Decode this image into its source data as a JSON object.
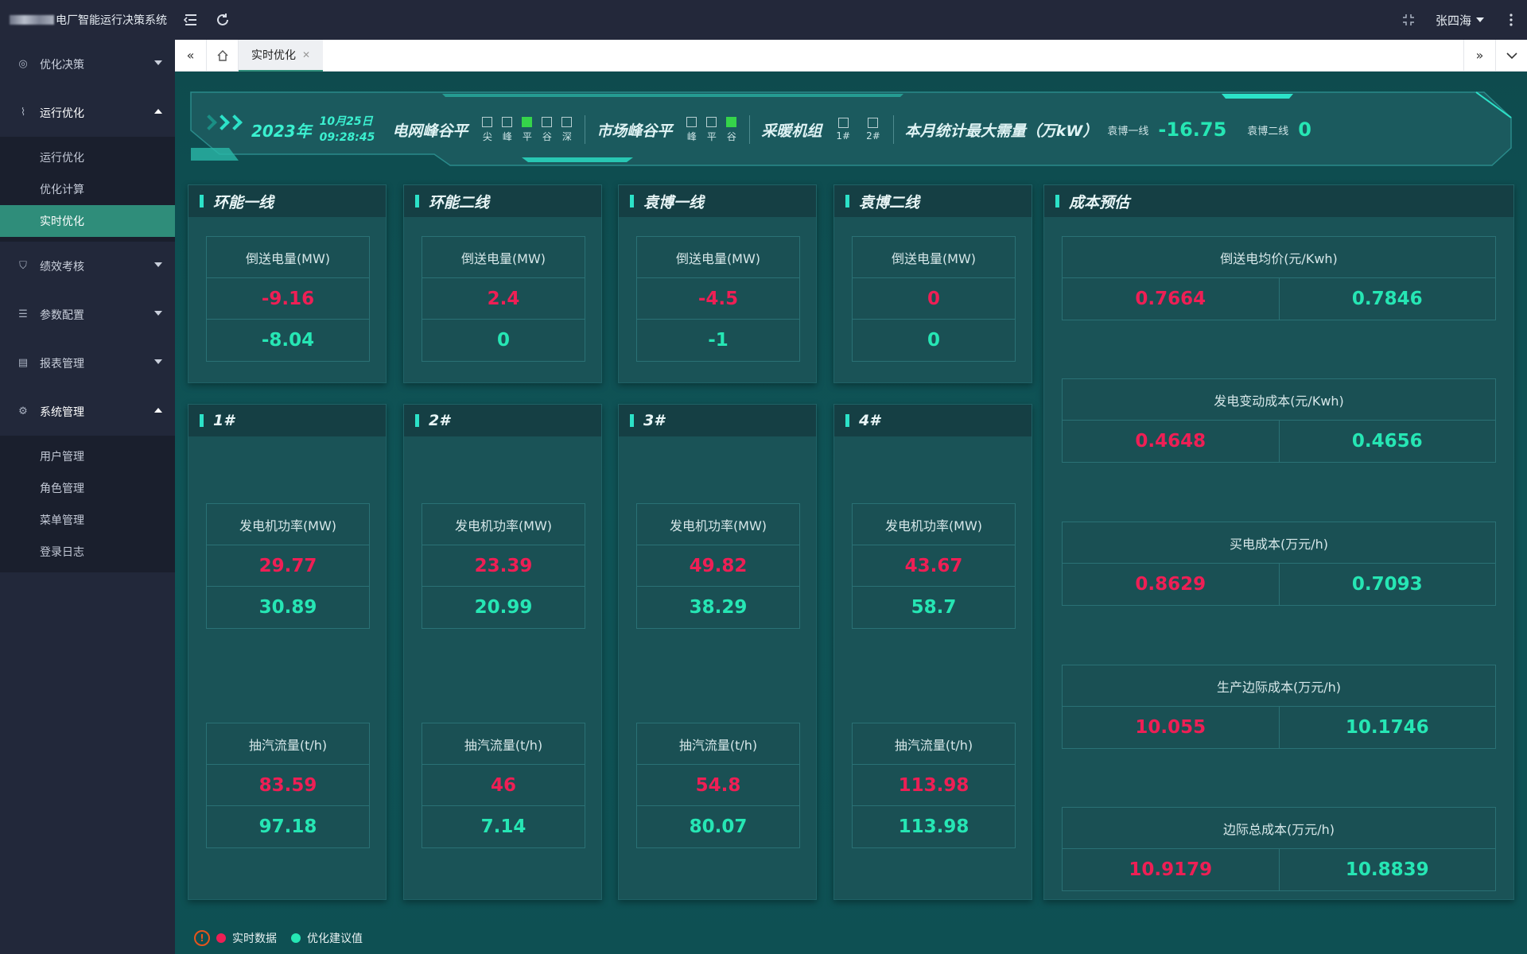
{
  "app": {
    "title": "电厂智能运行决策系统",
    "user": "张四海"
  },
  "sidebar": {
    "groups": [
      {
        "label": "优化决策",
        "icon": "target-icon"
      },
      {
        "label": "运行优化",
        "icon": "pulse-icon",
        "items": [
          "运行优化",
          "优化计算",
          "实时优化"
        ],
        "active_item": "实时优化"
      },
      {
        "label": "绩效考核",
        "icon": "shield-icon"
      },
      {
        "label": "参数配置",
        "icon": "sliders-icon"
      },
      {
        "label": "报表管理",
        "icon": "clipboard-icon"
      },
      {
        "label": "系统管理",
        "icon": "gear-icon",
        "items": [
          "用户管理",
          "角色管理",
          "菜单管理",
          "登录日志"
        ]
      }
    ]
  },
  "tabs": [
    {
      "label": "实时优化"
    }
  ],
  "header": {
    "year": "2023年",
    "date": "10月25日",
    "time": "09:28:45",
    "grid_title": "电网峰谷平",
    "grid_indicators": [
      {
        "label": "尖",
        "on": false
      },
      {
        "label": "峰",
        "on": false
      },
      {
        "label": "平",
        "on": true
      },
      {
        "label": "谷",
        "on": false
      },
      {
        "label": "深",
        "on": false
      }
    ],
    "market_title": "市场峰谷平",
    "market_indicators": [
      {
        "label": "峰",
        "on": false
      },
      {
        "label": "平",
        "on": false
      },
      {
        "label": "谷",
        "on": true
      }
    ],
    "heating_title": "采暖机组",
    "heating_indicators": [
      {
        "label": "1#",
        "on": false
      },
      {
        "label": "2#",
        "on": false
      }
    ],
    "max_demand_title": "本月统计最大需量（万kW）",
    "line1_label": "袁博一线",
    "line1_value": "-16.75",
    "line2_label": "袁博二线",
    "line2_value": "0"
  },
  "lines": [
    {
      "title": "环能一线",
      "label": "倒送电量(MW)",
      "real": "-9.16",
      "opt": "-8.04"
    },
    {
      "title": "环能二线",
      "label": "倒送电量(MW)",
      "real": "2.4",
      "opt": "0"
    },
    {
      "title": "袁博一线",
      "label": "倒送电量(MW)",
      "real": "-4.5",
      "opt": "-1"
    },
    {
      "title": "袁博二线",
      "label": "倒送电量(MW)",
      "real": "0",
      "opt": "0"
    }
  ],
  "units": [
    {
      "title": "1#",
      "power_label": "发电机功率(MW)",
      "power_real": "29.77",
      "power_opt": "30.89",
      "flow_label": "抽汽流量(t/h)",
      "flow_real": "83.59",
      "flow_opt": "97.18"
    },
    {
      "title": "2#",
      "power_label": "发电机功率(MW)",
      "power_real": "23.39",
      "power_opt": "20.99",
      "flow_label": "抽汽流量(t/h)",
      "flow_real": "46",
      "flow_opt": "7.14"
    },
    {
      "title": "3#",
      "power_label": "发电机功率(MW)",
      "power_real": "49.82",
      "power_opt": "38.29",
      "flow_label": "抽汽流量(t/h)",
      "flow_real": "54.8",
      "flow_opt": "80.07"
    },
    {
      "title": "4#",
      "power_label": "发电机功率(MW)",
      "power_real": "43.67",
      "power_opt": "58.7",
      "flow_label": "抽汽流量(t/h)",
      "flow_real": "113.98",
      "flow_opt": "113.98"
    }
  ],
  "cost": {
    "title": "成本预估",
    "rows": [
      {
        "label": "倒送电均价(元/Kwh)",
        "real": "0.7664",
        "opt": "0.7846"
      },
      {
        "label": "发电变动成本(元/Kwh)",
        "real": "0.4648",
        "opt": "0.4656"
      },
      {
        "label": "买电成本(万元/h)",
        "real": "0.8629",
        "opt": "0.7093"
      },
      {
        "label": "生产边际成本(万元/h)",
        "real": "10.055",
        "opt": "10.1746"
      },
      {
        "label": "边际总成本(万元/h)",
        "real": "10.9179",
        "opt": "10.8839"
      }
    ]
  },
  "legend": {
    "realtime": "实时数据",
    "optimized": "优化建议值"
  },
  "colors": {
    "realtime": "#ee1f55",
    "optimized": "#26e6b4",
    "accent": "#2f8d7a",
    "indicator_on": "#35d44a"
  }
}
